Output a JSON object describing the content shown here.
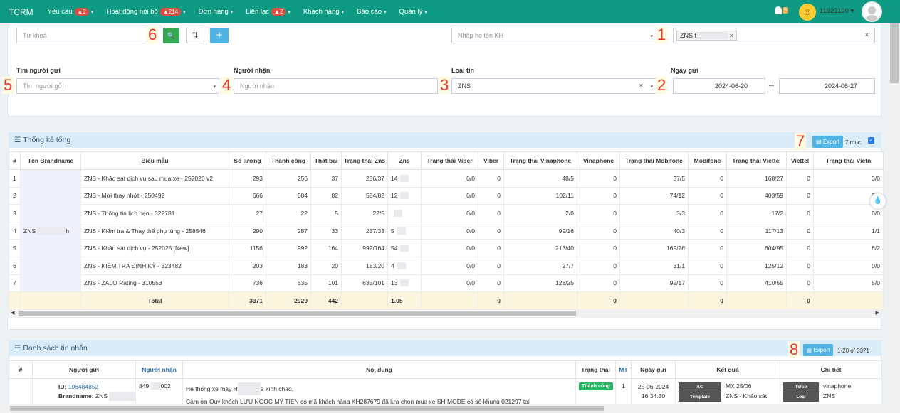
{
  "nav": {
    "brand": "TCRM",
    "items": [
      {
        "label": "Yêu cầu",
        "badge": "2"
      },
      {
        "label": "Hoạt động nội bộ",
        "badge": "214"
      },
      {
        "label": "Đơn hàng",
        "badge": ""
      },
      {
        "label": "Liên lạc",
        "badge": "2"
      },
      {
        "label": "Khách hàng",
        "badge": ""
      },
      {
        "label": "Báo cáo",
        "badge": ""
      },
      {
        "label": "Quản lý",
        "badge": ""
      }
    ],
    "bell_badge": "9",
    "user": "11921100"
  },
  "filters": {
    "keyword_placeholder": "Từ khoá",
    "customer_placeholder": "Nhập họ tên KH",
    "tag_value": "ZNS t",
    "clear": "×",
    "tag_remove": "×",
    "sender_label": "Tìm người gửi",
    "sender_placeholder": "Tìm người gửi",
    "recipient_label": "Người nhận",
    "recipient_placeholder": "Người nhận",
    "type_label": "Loại tin",
    "type_value": "ZNS",
    "date_label": "Ngày gửi",
    "date_from": "2024-06-20",
    "date_to": "2024-06-27",
    "date_sep": "↔",
    "search_icon": "🔍",
    "sort_icon": "⇅",
    "add_icon": "+"
  },
  "callouts": [
    "1",
    "2",
    "3",
    "4",
    "5",
    "6",
    "7",
    "8"
  ],
  "summary": {
    "title": "Thống kê tổng",
    "export": "Export",
    "count": "7 mục.",
    "columns": [
      "#",
      "Tên Brandname",
      "Biểu mẫu",
      "Số lượng",
      "Thành công",
      "Thất bại",
      "Trạng thái Zns",
      "Zns",
      "Trạng thái Viber",
      "Viber",
      "Trạng thái Vinaphone",
      "Vinaphone",
      "Trạng thái Mobifone",
      "Mobifone",
      "Trạng thái Viettel",
      "Viettel",
      "Trạng thái Vietn"
    ],
    "brand": "ZNS ",
    "brand_tail": "h",
    "rows": [
      [
        "1",
        "ZNS - Khảo sát dịch vụ sau mua xe - 252026 v2",
        "293",
        "256",
        "37",
        "256/37",
        "14",
        "0/0",
        "0",
        "48/5",
        "0",
        "37/5",
        "0",
        "168/27",
        "0",
        "3/0"
      ],
      [
        "2",
        "ZNS - Mời thay nhớt - 250492",
        "666",
        "584",
        "82",
        "584/82",
        "12",
        "0/0",
        "0",
        "102/11",
        "0",
        "74/12",
        "0",
        "403/59",
        "0",
        "5/0"
      ],
      [
        "3",
        "ZNS - Thông tin lịch hẹn - 322781",
        "27",
        "22",
        "5",
        "22/5",
        "",
        "0/0",
        "0",
        "2/0",
        "0",
        "3/3",
        "0",
        "17/2",
        "0",
        "0/0"
      ],
      [
        "4",
        "ZNS - Kiểm tra & Thay thế phụ tùng - 258546",
        "290",
        "257",
        "33",
        "257/33",
        "5",
        "0/0",
        "0",
        "99/16",
        "0",
        "40/3",
        "0",
        "117/13",
        "0",
        "1/1"
      ],
      [
        "5",
        "ZNS - Khảo sát dịch vụ - 252025 [New]",
        "1156",
        "992",
        "164",
        "992/164",
        "54",
        "0/0",
        "0",
        "213/40",
        "0",
        "169/26",
        "0",
        "604/95",
        "0",
        "6/2"
      ],
      [
        "6",
        "ZNS - KIỂM TRA ĐỊNH KỲ - 323482",
        "203",
        "183",
        "20",
        "183/20",
        "4",
        "0/0",
        "0",
        "27/7",
        "0",
        "31/1",
        "0",
        "125/12",
        "0",
        "0/0"
      ],
      [
        "7",
        "ZNS - ZALO Rating - 310553",
        "736",
        "635",
        "101",
        "635/101",
        "13",
        "0/0",
        "0",
        "128/25",
        "0",
        "92/17",
        "0",
        "410/55",
        "0",
        "5/0"
      ]
    ],
    "total": {
      "label": "Total",
      "qty": "3371",
      "ok": "2929",
      "fail": "442",
      "zns": "1.05",
      "viber": "0",
      "vina": "0",
      "mobi": "0",
      "viettel": "0"
    }
  },
  "messages": {
    "title": "Danh sách tin nhắn",
    "export": "Export",
    "range": "1-20 of 3371",
    "columns": [
      "#",
      "Người gửi",
      "Người nhận",
      "Nội dung",
      "Trạng thái",
      "MT",
      "Ngày gửi",
      "Kết quả",
      "Chi tiết"
    ],
    "row": {
      "id_label": "ID:",
      "id": "106484852",
      "brand_label": "Brandname:",
      "brand": "ZNS ",
      "brand_tail": "h",
      "recipient": "849",
      "recipient_tail": "002",
      "content1": "Hệ thống xe máy H",
      "content1_tail": "a kính chào,",
      "content2": "Cảm ơn Quý khách LƯU NGỌC MỸ TIÊN có mã khách hàng KH287679 đã lựa chọn mua xe SH MODE có số khung 021297 tại",
      "status": "Thành công",
      "mt": "1",
      "date": "25-06-2024",
      "time": "16:34:50",
      "res": [
        {
          "k": "AC",
          "v": "MX 25/06"
        },
        {
          "k": "Template",
          "v": "ZNS - Khảo sát"
        }
      ],
      "det": [
        {
          "k": "Telco",
          "v": "vinaphone"
        },
        {
          "k": "Loại",
          "v": "ZNS"
        }
      ]
    }
  }
}
